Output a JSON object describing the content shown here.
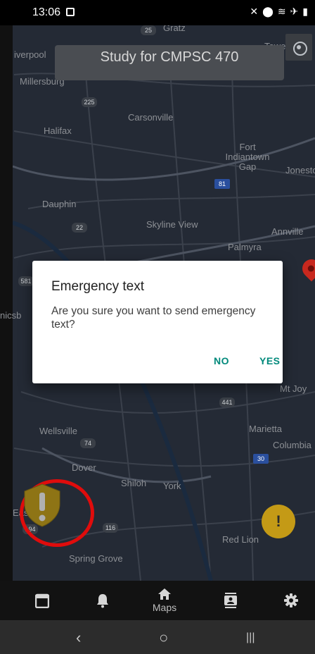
{
  "status_bar": {
    "time": "13:06",
    "right_icons": [
      "mute-icon",
      "location-icon",
      "wifi-icon",
      "airplane-icon",
      "battery-icon"
    ]
  },
  "map": {
    "labels": [
      "Gratz",
      "Tower City",
      "iverpool",
      "Millersburg",
      "Carsonville",
      "Halifax",
      "Fort Indiantown Gap",
      "Jonesto",
      "Dauphin",
      "Skyline View",
      "Annville",
      "Palmyra",
      "nicsb",
      "Mt Joy",
      "Wellsville",
      "Marietta",
      "Columbia",
      "Dover",
      "Shiloh",
      "York",
      "East B",
      "Red Lion",
      "Spring Grove"
    ],
    "route_shields": [
      "25",
      "225",
      "81",
      "22",
      "581",
      "441",
      "74",
      "30",
      "116",
      "194"
    ],
    "title": "Study for CMPSC 470"
  },
  "dialog": {
    "title": "Emergency text",
    "message": "Are you sure you want to send emergency text?",
    "no_label": "NO",
    "yes_label": "YES"
  },
  "fab": {
    "label": "!"
  },
  "bottom_nav": {
    "items": [
      {
        "icon": "calendar-icon"
      },
      {
        "icon": "bell-icon"
      },
      {
        "icon": "home-icon",
        "label": "Maps"
      },
      {
        "icon": "contacts-icon"
      },
      {
        "icon": "gear-icon"
      }
    ]
  },
  "system_nav": {
    "back": "‹",
    "home": "○",
    "recents": "|||"
  },
  "colors": {
    "accent": "#00897b",
    "sos_ring": "#e00c0c",
    "sos_yellow": "#c49a16",
    "map_bg": "#242a35"
  }
}
